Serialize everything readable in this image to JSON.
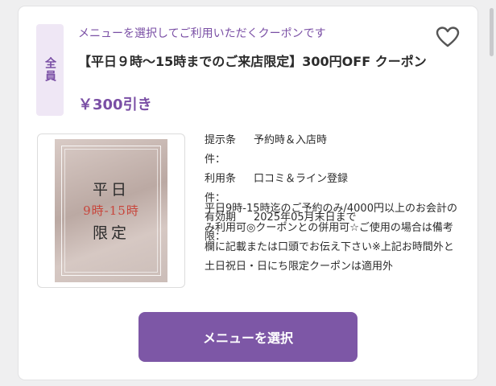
{
  "coupon": {
    "badge": "全員",
    "note": "メニューを選択してご利用いただくクーポンです",
    "title": "【平日９時〜15時までのご来店限定】300円OFF クーポン",
    "price": "￥300引き",
    "favorite_icon": "heart-outline-icon",
    "image_text": {
      "line1": "平日",
      "line2": "9時-15時",
      "line3": "限定"
    },
    "conditions": [
      {
        "label": "提示条件：",
        "value": "予約時＆入店時"
      },
      {
        "label": "利用条件：",
        "value": "口コミ＆ライン登録"
      },
      {
        "label": "有効期限：",
        "value": "2025年05月末日まで"
      }
    ],
    "description": "平日9時-15時迄のご予約のみ/4000円以上のお会計のみ利用可◎クーポンとの併用可☆ご使用の場合は備考欄に記載または口頭でお伝え下さい※上記お時間外と土日祝日・日にち限定クーポンは適用外",
    "button_label": "メニューを選択"
  },
  "colors": {
    "accent": "#7d57a6",
    "accent_text": "#7a4fa5",
    "badge_bg": "#efe7f5",
    "image_red_text": "#c8463c"
  }
}
